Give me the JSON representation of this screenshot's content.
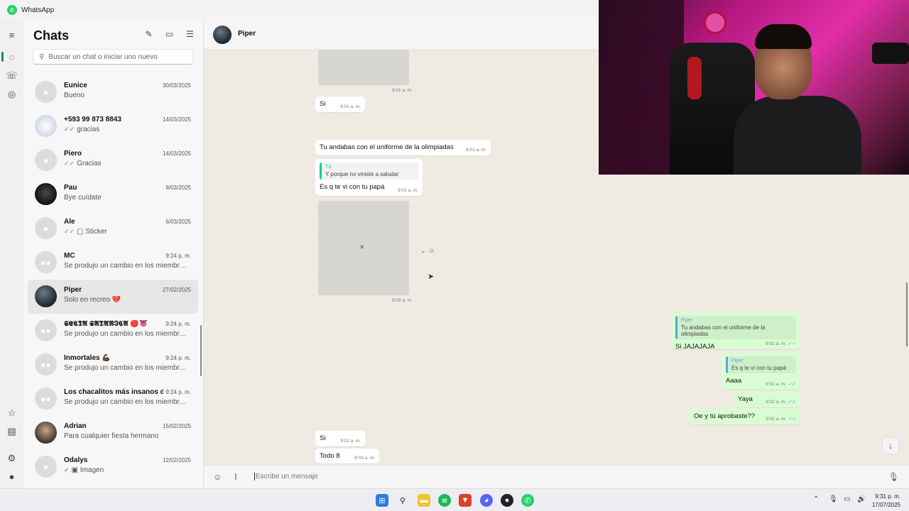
{
  "app": {
    "title": "WhatsApp"
  },
  "sidebar": {
    "title": "Chats",
    "search_placeholder": "Buscar un chat o iniciar uno nuevo",
    "chats": [
      {
        "name": "Eunice",
        "date": "30/03/2025",
        "preview": "Bueno",
        "tick": ""
      },
      {
        "name": "+593 99 873 8843",
        "date": "14/03/2025",
        "preview": "gracias",
        "tick": "✓✓"
      },
      {
        "name": "Piero",
        "date": "14/03/2025",
        "preview": "Gracias",
        "tick": "✓✓"
      },
      {
        "name": "Pau",
        "date": "8/03/2025",
        "preview": "Bye cuídate",
        "tick": ""
      },
      {
        "name": "Ale",
        "date": "6/03/2025",
        "preview": "Sticker",
        "tick": "✓✓"
      },
      {
        "name": "MC",
        "date": "9:24 p. m.",
        "preview": "Se produjo un cambio en los miembros...",
        "tick": ""
      },
      {
        "name": "Piper",
        "date": "27/02/2025",
        "preview": "Solo en recreo 💔",
        "tick": ""
      },
      {
        "name": "𝕾𝕰𝕮𝕿𝕬 𝕾𝕬𝕿𝕬𝕹𝕴𝕮𝕬 🔴👅",
        "date": "9:24 p. m.",
        "preview": "Se produjo un cambio en los miembros...",
        "tick": ""
      },
      {
        "name": "Inmortales 💪🏿",
        "date": "9:24 p. m.",
        "preview": "Se produjo un cambio en los miembros...",
        "tick": ""
      },
      {
        "name": "Los chacalitos más insanos de...",
        "date": "9:24 p. m.",
        "preview": "Se produjo un cambio en los miembros...",
        "tick": ""
      },
      {
        "name": "Adrian",
        "date": "15/02/2025",
        "preview": "Para cualquier fiesta hermano",
        "tick": ""
      },
      {
        "name": "Odalys",
        "date": "12/02/2025",
        "preview": "Imagen",
        "tick": "✓"
      }
    ]
  },
  "conversation": {
    "contact_name": "Piper",
    "messages": {
      "m1_text": "Si",
      "m1_time": "9:01 a. m.",
      "img1_time": "9:01 a. m.",
      "m2_text": "Tu andabas con el uniforme de la olimpiadas",
      "m2_time": "9:01 a. m.",
      "m3_quote_name": "Tú",
      "m3_quote_text": "Y porque no viniste a saludar",
      "m3_text": "Es q te vi con tu papá",
      "m3_time": "9:01 a. m.",
      "img2_time": "9:02 a. m.",
      "o1_quote_name": "Piper",
      "o1_quote_text": "Tu andabas con el uniforme de la olimpiadas",
      "o1_text": "Si JAJAJAJA",
      "o1_time": "9:02 a. m.",
      "o2_quote_name": "Piper",
      "o2_quote_text": "Es q te vi con tu papá",
      "o2_text": "Aaaa",
      "o2_time": "9:02 a. m.",
      "o3_text": "Yaya",
      "o3_time": "9:02 a. m.",
      "o4_text": "Oe y tú aprobaste??",
      "o4_time": "9:02 a. m.",
      "m4_text": "Si",
      "m4_time": "9:02 a. m.",
      "m5_text": "Todo 8",
      "m5_time": "9:03 a. m."
    },
    "composer_placeholder": "Escribe un mensaje"
  },
  "taskbar": {
    "time": "9:31 p. m.",
    "date": "17/07/2025"
  },
  "colors": {
    "accent": "#25d366",
    "outgoing_bubble": "#d9fdd3",
    "read_tick": "#4a90d9"
  }
}
